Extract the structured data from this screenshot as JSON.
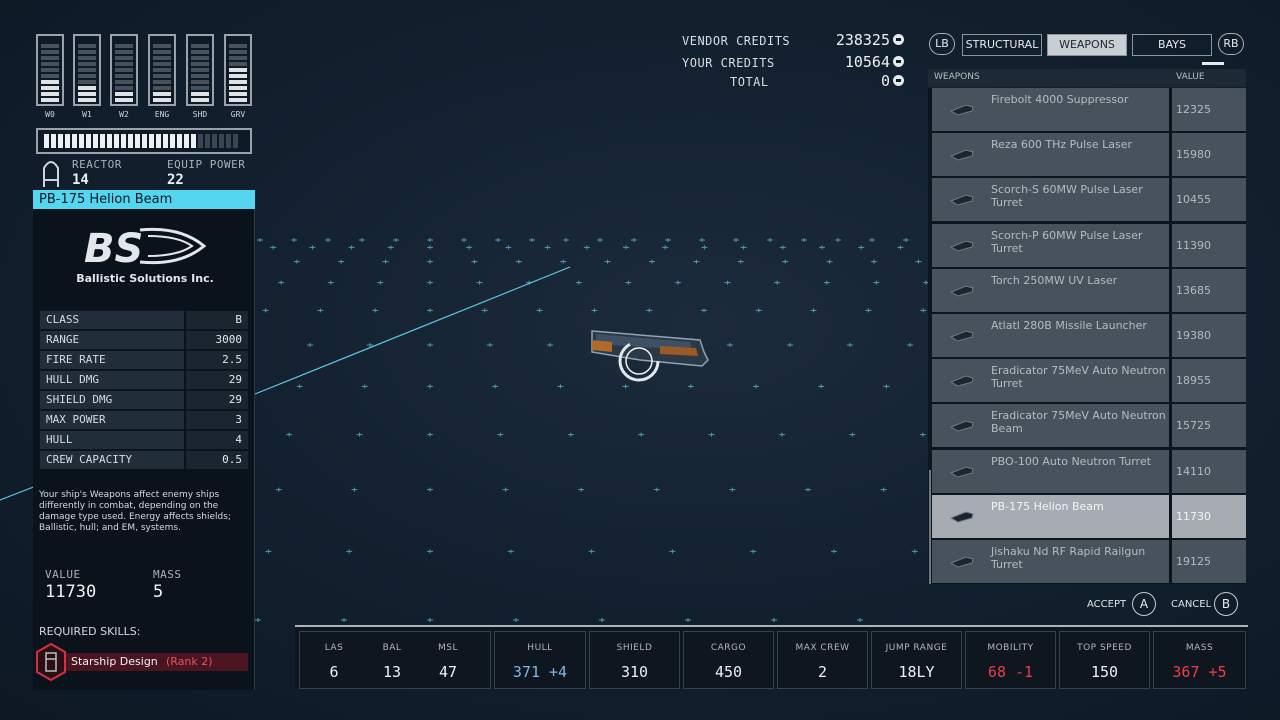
{
  "power_bars": [
    {
      "label": "W0",
      "filled": 4
    },
    {
      "label": "W1",
      "filled": 3
    },
    {
      "label": "W2",
      "filled": 2
    },
    {
      "label": "ENG",
      "filled": 2
    },
    {
      "label": "SHD",
      "filled": 2
    },
    {
      "label": "GRV",
      "filled": 6
    }
  ],
  "reactor": {
    "label": "REACTOR",
    "value": "14",
    "equip_label": "EQUIP POWER",
    "equip_value": "22",
    "filled": 22,
    "total": 28
  },
  "item": {
    "title": "PB-175 Helion Beam",
    "brand_logo_text": "BS",
    "brand_name": "Ballistic Solutions Inc.",
    "stats": [
      {
        "key": "CLASS",
        "value": "B"
      },
      {
        "key": "RANGE",
        "value": "3000"
      },
      {
        "key": "FIRE RATE",
        "value": "2.5"
      },
      {
        "key": "HULL DMG",
        "value": "29"
      },
      {
        "key": "SHIELD DMG",
        "value": "29"
      },
      {
        "key": "MAX POWER",
        "value": "3"
      },
      {
        "key": "HULL",
        "value": "4"
      },
      {
        "key": "CREW CAPACITY",
        "value": "0.5"
      }
    ],
    "description": "Your ship's Weapons affect enemy ships differently in combat, depending on the damage type used. Energy affects shields; Ballistic, hull; and EM, systems.",
    "value_label": "VALUE",
    "value": "11730",
    "mass_label": "MASS",
    "mass": "5",
    "required_label": "REQUIRED SKILLS:",
    "skill_name": "Starship Design",
    "skill_rank": "(Rank 2)"
  },
  "credits": {
    "vendor_label": "VENDOR CREDITS",
    "vendor_value": "238325",
    "your_label": "YOUR CREDITS",
    "your_value": "10564",
    "total_label": "TOTAL",
    "total_value": "0"
  },
  "tabs": {
    "left_bumper": "LB",
    "right_bumper": "RB",
    "items": [
      "STRUCTURAL",
      "WEAPONS",
      "BAYS"
    ],
    "active": 1
  },
  "list": {
    "col_name": "WEAPONS",
    "col_value": "VALUE",
    "rows": [
      {
        "name": "Firebolt 4000 Suppressor",
        "value": "12325"
      },
      {
        "name": "Reza 600 THz Pulse Laser",
        "value": "15980"
      },
      {
        "name": "Scorch-S 60MW Pulse Laser Turret",
        "value": "10455"
      },
      {
        "name": "Scorch-P 60MW Pulse Laser Turret",
        "value": "11390"
      },
      {
        "name": "Torch 250MW UV Laser",
        "value": "13685"
      },
      {
        "name": "Atlatl 280B Missile Launcher",
        "value": "19380"
      },
      {
        "name": "Eradicator 75MeV Auto Neutron Turret",
        "value": "18955"
      },
      {
        "name": "Eradicator 75MeV Auto Neutron Beam",
        "value": "15725"
      },
      {
        "name": "PBO-100 Auto Neutron Turret",
        "value": "14110"
      },
      {
        "name": "PB-175 Helion Beam",
        "value": "11730"
      },
      {
        "name": "Jishaku Nd RF Rapid Railgun Turret",
        "value": "19125"
      }
    ],
    "selected": 9
  },
  "actions": {
    "accept_label": "ACCEPT",
    "accept_key": "A",
    "cancel_label": "CANCEL",
    "cancel_key": "B"
  },
  "ship_stats": {
    "las": {
      "label": "LAS",
      "value": "6"
    },
    "bal": {
      "label": "BAL",
      "value": "13"
    },
    "msl": {
      "label": "MSL",
      "value": "47"
    },
    "hull": {
      "label": "HULL",
      "value": "371",
      "delta": "+4"
    },
    "shield": {
      "label": "SHIELD",
      "value": "310"
    },
    "cargo": {
      "label": "CARGO",
      "value": "450"
    },
    "crew": {
      "label": "MAX CREW",
      "value": "2"
    },
    "jump": {
      "label": "JUMP RANGE",
      "value": "18LY"
    },
    "mobility": {
      "label": "MOBILITY",
      "value": "68",
      "delta": "-1"
    },
    "speed": {
      "label": "TOP SPEED",
      "value": "150"
    },
    "mass": {
      "label": "MASS",
      "value": "367",
      "delta": "+5"
    }
  },
  "colors": {
    "accent": "#55d6f0",
    "negative": "#f23b46",
    "positive": "#7fb5e6",
    "selected_row": "#a6acb2"
  }
}
